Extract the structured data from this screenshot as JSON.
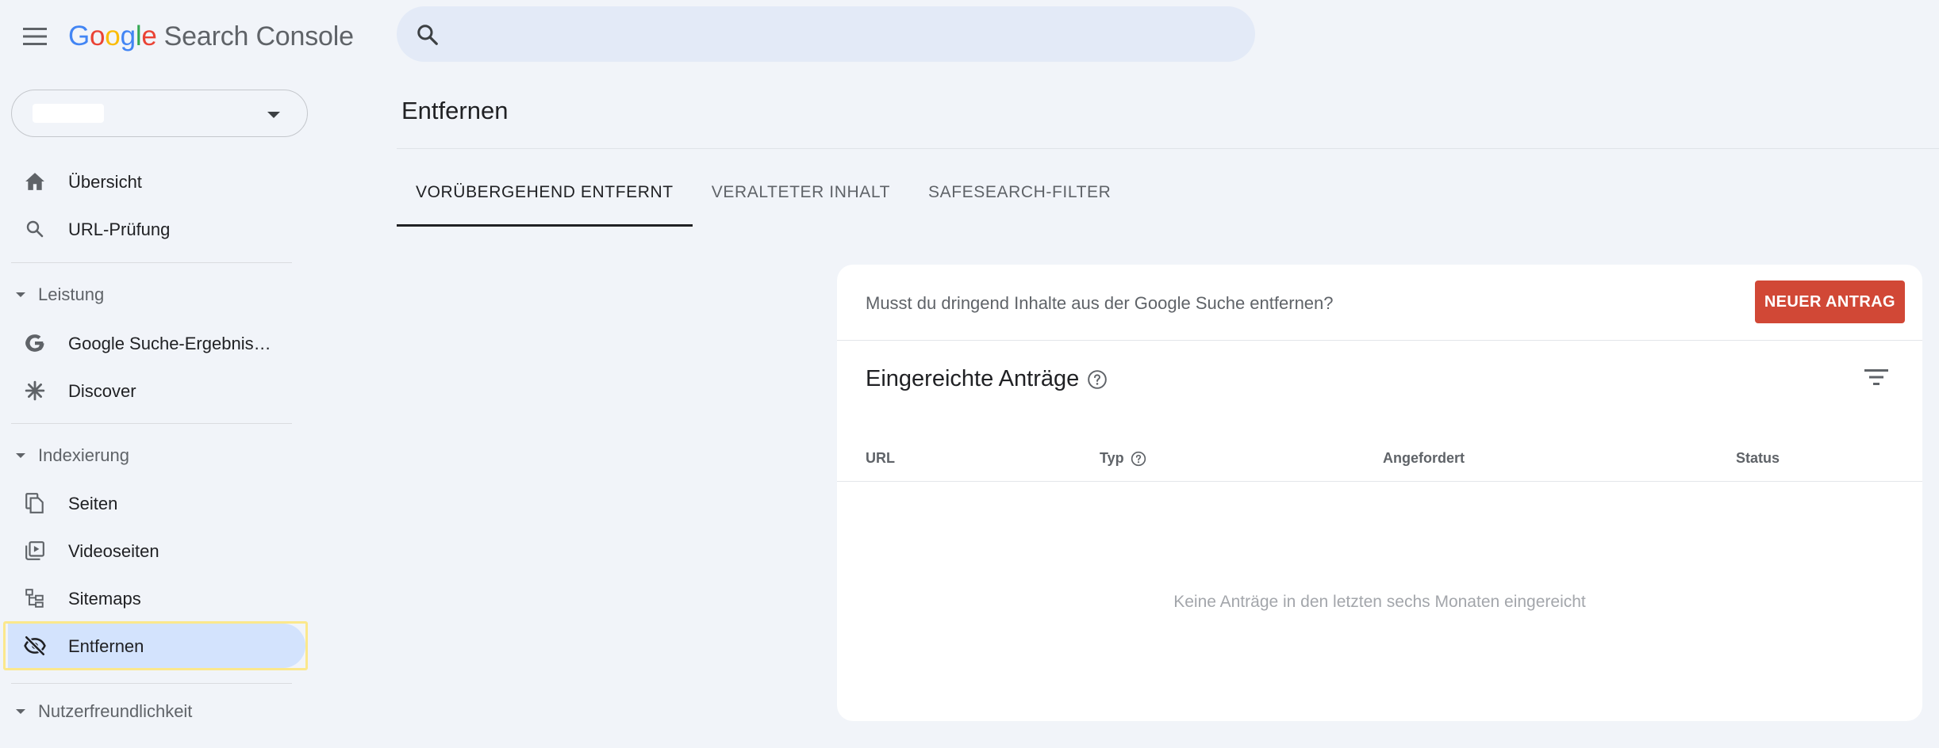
{
  "header": {
    "logo_google": [
      "G",
      "o",
      "o",
      "g",
      "l",
      "e"
    ],
    "logo_product": "Search Console",
    "search_value": "",
    "colors": {
      "blue": "#4285f4",
      "red": "#ea4335",
      "yellow": "#fbbc05",
      "green": "#34a853"
    }
  },
  "sidebar": {
    "items_top": [
      {
        "label": "Übersicht",
        "icon": "home-icon"
      },
      {
        "label": "URL-Prüfung",
        "icon": "search-icon"
      }
    ],
    "sections": [
      {
        "label": "Leistung",
        "items": [
          {
            "label": "Google Suche-Ergebnis…",
            "icon": "google-g-icon"
          },
          {
            "label": "Discover",
            "icon": "asterisk-icon"
          }
        ]
      },
      {
        "label": "Indexierung",
        "items": [
          {
            "label": "Seiten",
            "icon": "pages-icon"
          },
          {
            "label": "Videoseiten",
            "icon": "video-pages-icon"
          },
          {
            "label": "Sitemaps",
            "icon": "sitemap-icon"
          },
          {
            "label": "Entfernen",
            "icon": "visibility-off-icon",
            "active": true
          }
        ]
      },
      {
        "label": "Nutzerfreundlichkeit",
        "items": []
      }
    ]
  },
  "main": {
    "title": "Entfernen",
    "tabs": [
      {
        "label": "VORÜBERGEHEND ENTFERNT",
        "active": true
      },
      {
        "label": "VERALTETER INHALT",
        "active": false
      },
      {
        "label": "SAFESEARCH-FILTER",
        "active": false
      }
    ],
    "banner": {
      "text": "Musst du dringend Inhalte aus der Google Suche entfernen?",
      "button": "NEUER ANTRAG",
      "button_color": "#d14836"
    },
    "card_title": "Eingereichte Anträge",
    "columns": [
      "URL",
      "Typ",
      "Angefordert",
      "Status"
    ],
    "empty_message": "Keine Anträge in den letzten sechs Monaten eingereicht"
  }
}
